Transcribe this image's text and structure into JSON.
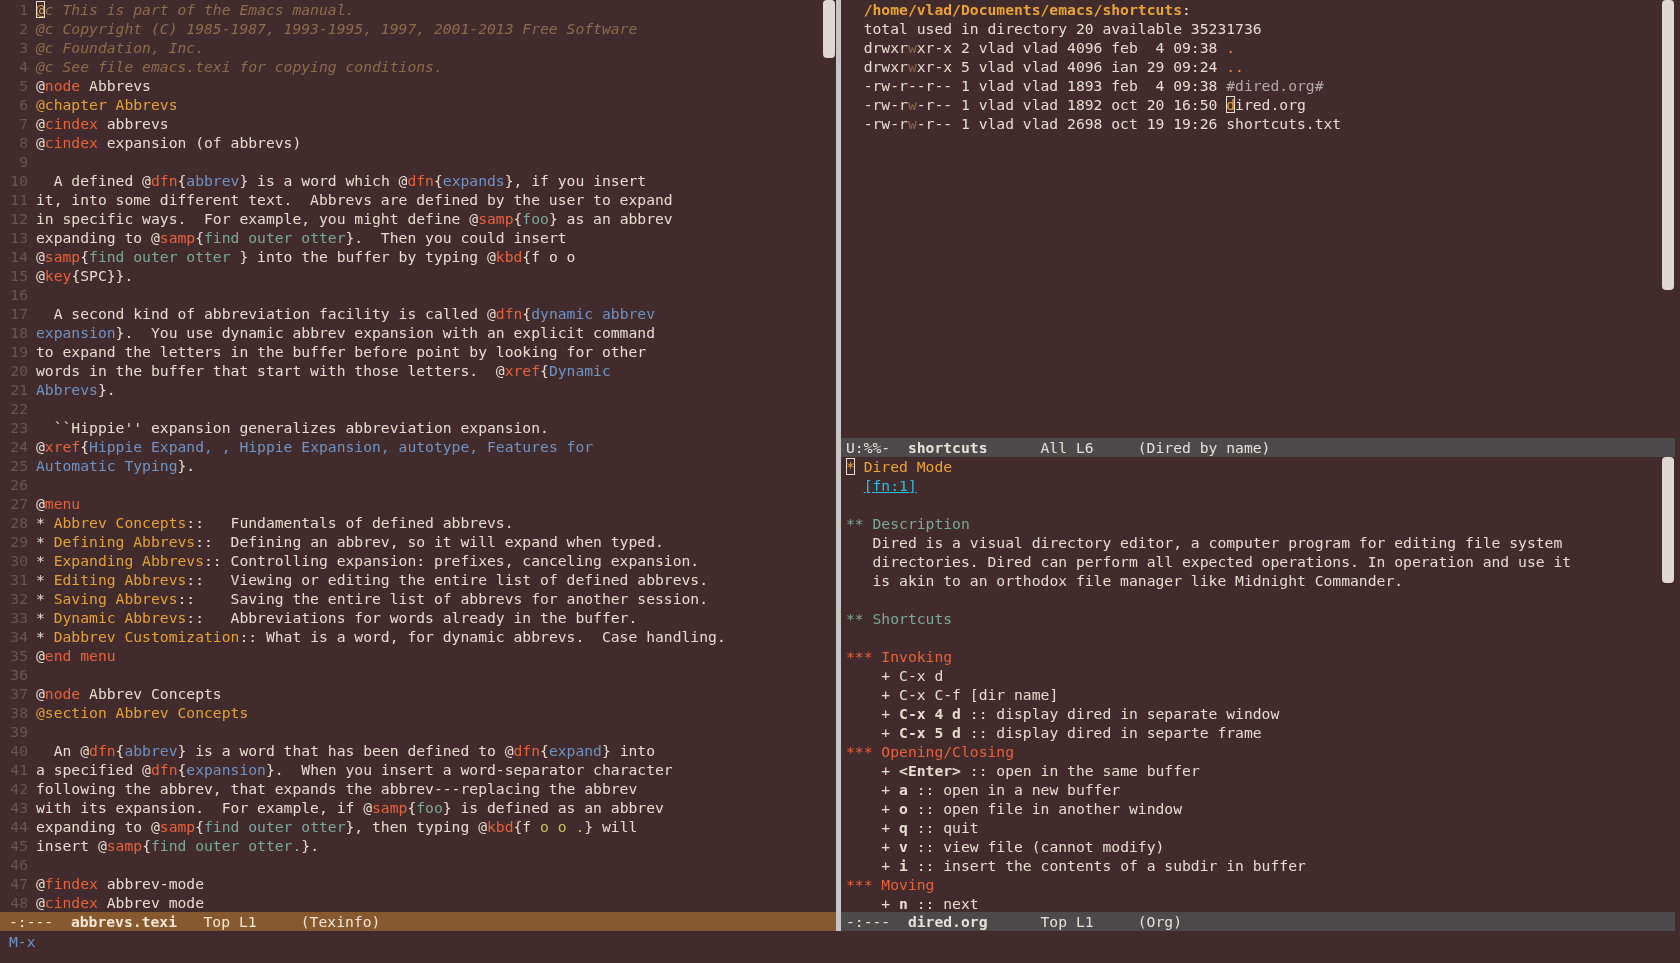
{
  "columns": [
    {
      "windows": [
        {
          "kind": "source",
          "lines": [
            {
              "number": "1",
              "spans": [
                {
                  "kind": "cursor",
                  "text": "@"
                },
                {
                  "kind": "comment",
                  "text": "c This is part of the Emacs manual."
                }
              ]
            },
            {
              "number": "2",
              "spans": [
                {
                  "kind": "comment",
                  "text": "@c Copyright (C) 1985-1987, 1993-1995, 1997, 2001-2013 Free Software"
                }
              ]
            },
            {
              "number": "3",
              "spans": [
                {
                  "kind": "comment",
                  "text": "@c Foundation, Inc."
                }
              ]
            },
            {
              "number": "4",
              "spans": [
                {
                  "kind": "comment",
                  "text": "@c See file emacs.texi for copying conditions."
                }
              ]
            },
            {
              "number": "5",
              "spans": [
                {
                  "kind": "plain",
                  "text": "@"
                },
                {
                  "kind": "keyword",
                  "text": "node"
                },
                {
                  "kind": "plain",
                  "text": " Abbrevs"
                }
              ]
            },
            {
              "number": "6",
              "spans": [
                {
                  "kind": "heading",
                  "text": "@chapter Abbrevs"
                }
              ]
            },
            {
              "number": "7",
              "spans": [
                {
                  "kind": "plain",
                  "text": "@"
                },
                {
                  "kind": "keyword",
                  "text": "cindex"
                },
                {
                  "kind": "plain",
                  "text": " abbrevs"
                }
              ]
            },
            {
              "number": "8",
              "spans": [
                {
                  "kind": "plain",
                  "text": "@"
                },
                {
                  "kind": "keyword",
                  "text": "cindex"
                },
                {
                  "kind": "plain",
                  "text": " expansion (of abbrevs)"
                }
              ]
            },
            {
              "number": "9"
            },
            {
              "number": "10",
              "spans": [
                {
                  "kind": "plain",
                  "text": "  A defined @"
                },
                {
                  "kind": "keyword",
                  "text": "dfn"
                },
                {
                  "kind": "plain",
                  "text": "{"
                },
                {
                  "kind": "ref",
                  "text": "abbrev"
                },
                {
                  "kind": "plain",
                  "text": "} is a word which @"
                },
                {
                  "kind": "keyword",
                  "text": "dfn"
                },
                {
                  "kind": "plain",
                  "text": "{"
                },
                {
                  "kind": "ref",
                  "text": "expands"
                },
                {
                  "kind": "plain",
                  "text": "}, if you insert"
                }
              ]
            },
            {
              "number": "11",
              "spans": [
                {
                  "kind": "plain",
                  "text": "it, into some different text.  Abbrevs are defined by the user to expand"
                }
              ]
            },
            {
              "number": "12",
              "spans": [
                {
                  "kind": "plain",
                  "text": "in specific ways.  For example, you might define @"
                },
                {
                  "kind": "keyword",
                  "text": "samp"
                },
                {
                  "kind": "plain",
                  "text": "{"
                },
                {
                  "kind": "sample",
                  "text": "foo"
                },
                {
                  "kind": "plain",
                  "text": "} as an abbrev"
                }
              ]
            },
            {
              "number": "13",
              "spans": [
                {
                  "kind": "plain",
                  "text": "expanding to @"
                },
                {
                  "kind": "keyword",
                  "text": "samp"
                },
                {
                  "kind": "plain",
                  "text": "{"
                },
                {
                  "kind": "sample",
                  "text": "find outer otter"
                },
                {
                  "kind": "plain",
                  "text": "}.  Then you could insert"
                }
              ]
            },
            {
              "number": "14",
              "spans": [
                {
                  "kind": "plain",
                  "text": "@"
                },
                {
                  "kind": "keyword",
                  "text": "samp"
                },
                {
                  "kind": "plain",
                  "text": "{"
                },
                {
                  "kind": "sample",
                  "text": "find outer otter "
                },
                {
                  "kind": "plain",
                  "text": "} into the buffer by typing @"
                },
                {
                  "kind": "keyword",
                  "text": "kbd"
                },
                {
                  "kind": "plain",
                  "text": "{f o o"
                }
              ]
            },
            {
              "number": "15",
              "spans": [
                {
                  "kind": "plain",
                  "text": "@"
                },
                {
                  "kind": "keyword",
                  "text": "key"
                },
                {
                  "kind": "plain",
                  "text": "{SPC}}."
                }
              ]
            },
            {
              "number": "16"
            },
            {
              "number": "17",
              "spans": [
                {
                  "kind": "plain",
                  "text": "  A second kind of abbreviation facility is called @"
                },
                {
                  "kind": "keyword",
                  "text": "dfn"
                },
                {
                  "kind": "plain",
                  "text": "{"
                },
                {
                  "kind": "ref",
                  "text": "dynamic abbrev"
                }
              ]
            },
            {
              "number": "18",
              "spans": [
                {
                  "kind": "ref",
                  "text": "expansion"
                },
                {
                  "kind": "plain",
                  "text": "}.  You use dynamic abbrev expansion with an explicit command"
                }
              ]
            },
            {
              "number": "19",
              "spans": [
                {
                  "kind": "plain",
                  "text": "to expand the letters in the buffer before point by looking for other"
                }
              ]
            },
            {
              "number": "20",
              "spans": [
                {
                  "kind": "plain",
                  "text": "words in the buffer that start with those letters.  @"
                },
                {
                  "kind": "keyword",
                  "text": "xref"
                },
                {
                  "kind": "plain",
                  "text": "{"
                },
                {
                  "kind": "ref",
                  "text": "Dynamic"
                }
              ]
            },
            {
              "number": "21",
              "spans": [
                {
                  "kind": "ref",
                  "text": "Abbrevs"
                },
                {
                  "kind": "plain",
                  "text": "}."
                }
              ]
            },
            {
              "number": "22"
            },
            {
              "number": "23",
              "spans": [
                {
                  "kind": "plain",
                  "text": "  ``Hippie'' expansion generalizes abbreviation expansion."
                }
              ]
            },
            {
              "number": "24",
              "spans": [
                {
                  "kind": "plain",
                  "text": "@"
                },
                {
                  "kind": "keyword",
                  "text": "xref"
                },
                {
                  "kind": "plain",
                  "text": "{"
                },
                {
                  "kind": "ref",
                  "text": "Hippie Expand, , Hippie Expansion, autotype, Features for"
                }
              ]
            },
            {
              "number": "25",
              "spans": [
                {
                  "kind": "ref",
                  "text": "Automatic Typing"
                },
                {
                  "kind": "plain",
                  "text": "}."
                }
              ]
            },
            {
              "number": "26"
            },
            {
              "number": "27",
              "spans": [
                {
                  "kind": "plain",
                  "text": "@"
                },
                {
                  "kind": "keyword",
                  "text": "menu"
                }
              ]
            },
            {
              "number": "28",
              "spans": [
                {
                  "kind": "plain",
                  "text": "* "
                },
                {
                  "kind": "heading",
                  "text": "Abbrev Concepts"
                },
                {
                  "kind": "plain",
                  "text": "::   Fundamentals of defined abbrevs."
                }
              ]
            },
            {
              "number": "29",
              "spans": [
                {
                  "kind": "plain",
                  "text": "* "
                },
                {
                  "kind": "heading",
                  "text": "Defining Abbrevs"
                },
                {
                  "kind": "plain",
                  "text": "::  Defining an abbrev, so it will expand when typed."
                }
              ]
            },
            {
              "number": "30",
              "spans": [
                {
                  "kind": "plain",
                  "text": "* "
                },
                {
                  "kind": "heading",
                  "text": "Expanding Abbrevs"
                },
                {
                  "kind": "plain",
                  "text": ":: Controlling expansion: prefixes, canceling expansion."
                }
              ]
            },
            {
              "number": "31",
              "spans": [
                {
                  "kind": "plain",
                  "text": "* "
                },
                {
                  "kind": "heading",
                  "text": "Editing Abbrevs"
                },
                {
                  "kind": "plain",
                  "text": "::   Viewing or editing the entire list of defined abbrevs."
                }
              ]
            },
            {
              "number": "32",
              "spans": [
                {
                  "kind": "plain",
                  "text": "* "
                },
                {
                  "kind": "heading",
                  "text": "Saving Abbrevs"
                },
                {
                  "kind": "plain",
                  "text": "::    Saving the entire list of abbrevs for another session."
                }
              ]
            },
            {
              "number": "33",
              "spans": [
                {
                  "kind": "plain",
                  "text": "* "
                },
                {
                  "kind": "heading",
                  "text": "Dynamic Abbrevs"
                },
                {
                  "kind": "plain",
                  "text": "::   Abbreviations for words already in the buffer."
                }
              ]
            },
            {
              "number": "34",
              "spans": [
                {
                  "kind": "plain",
                  "text": "* "
                },
                {
                  "kind": "heading",
                  "text": "Dabbrev Customization"
                },
                {
                  "kind": "plain",
                  "text": ":: What is a word, for dynamic abbrevs.  Case handling."
                }
              ]
            },
            {
              "number": "35",
              "spans": [
                {
                  "kind": "plain",
                  "text": "@"
                },
                {
                  "kind": "keyword",
                  "text": "end menu"
                }
              ]
            },
            {
              "number": "36"
            },
            {
              "number": "37",
              "spans": [
                {
                  "kind": "plain",
                  "text": "@"
                },
                {
                  "kind": "keyword",
                  "text": "node"
                },
                {
                  "kind": "plain",
                  "text": " Abbrev Concepts"
                }
              ]
            },
            {
              "number": "38",
              "spans": [
                {
                  "kind": "heading",
                  "text": "@section Abbrev Concepts"
                }
              ]
            },
            {
              "number": "39"
            },
            {
              "number": "40",
              "spans": [
                {
                  "kind": "plain",
                  "text": "  An @"
                },
                {
                  "kind": "keyword",
                  "text": "dfn"
                },
                {
                  "kind": "plain",
                  "text": "{"
                },
                {
                  "kind": "ref",
                  "text": "abbrev"
                },
                {
                  "kind": "plain",
                  "text": "} is a word that has been defined to @"
                },
                {
                  "kind": "keyword",
                  "text": "dfn"
                },
                {
                  "kind": "plain",
                  "text": "{"
                },
                {
                  "kind": "ref",
                  "text": "expand"
                },
                {
                  "kind": "plain",
                  "text": "} into"
                }
              ]
            },
            {
              "number": "41",
              "spans": [
                {
                  "kind": "plain",
                  "text": "a specified @"
                },
                {
                  "kind": "keyword",
                  "text": "dfn"
                },
                {
                  "kind": "plain",
                  "text": "{"
                },
                {
                  "kind": "ref",
                  "text": "expansion"
                },
                {
                  "kind": "plain",
                  "text": "}.  When you insert a word-separator character"
                }
              ]
            },
            {
              "number": "42",
              "spans": [
                {
                  "kind": "plain",
                  "text": "following the abbrev, that expands the abbrev---replacing the abbrev"
                }
              ]
            },
            {
              "number": "43",
              "spans": [
                {
                  "kind": "plain",
                  "text": "with its expansion.  For example, if @"
                },
                {
                  "kind": "keyword",
                  "text": "samp"
                },
                {
                  "kind": "plain",
                  "text": "{"
                },
                {
                  "kind": "sample",
                  "text": "foo"
                },
                {
                  "kind": "plain",
                  "text": "} is defined as an abbrev"
                }
              ]
            },
            {
              "number": "44",
              "spans": [
                {
                  "kind": "plain",
                  "text": "expanding to @"
                },
                {
                  "kind": "keyword",
                  "text": "samp"
                },
                {
                  "kind": "plain",
                  "text": "{"
                },
                {
                  "kind": "sample",
                  "text": "find outer otter"
                },
                {
                  "kind": "plain",
                  "text": "}, then typing @"
                },
                {
                  "kind": "keyword",
                  "text": "kbd"
                },
                {
                  "kind": "plain",
                  "text": "{f "
                },
                {
                  "kind": "keys",
                  "text": "o o ."
                },
                {
                  "kind": "plain",
                  "text": "} will"
                }
              ]
            },
            {
              "number": "45",
              "spans": [
                {
                  "kind": "plain",
                  "text": "insert @"
                },
                {
                  "kind": "keyword",
                  "text": "samp"
                },
                {
                  "kind": "plain",
                  "text": "{"
                },
                {
                  "kind": "sample",
                  "text": "find outer otter."
                },
                {
                  "kind": "plain",
                  "text": "}."
                }
              ]
            },
            {
              "number": "46"
            },
            {
              "number": "47",
              "spans": [
                {
                  "kind": "plain",
                  "text": "@"
                },
                {
                  "kind": "keyword",
                  "text": "findex"
                },
                {
                  "kind": "plain",
                  "text": " abbrev-mode"
                }
              ]
            },
            {
              "number": "48",
              "spans": [
                {
                  "kind": "plain",
                  "text": "@"
                },
                {
                  "kind": "keyword",
                  "text": "cindex"
                },
                {
                  "kind": "plain",
                  "text": " Abbrev mode"
                }
              ]
            }
          ],
          "mode_line": {
            "status": "-:---",
            "buffer": "abbrevs.texi",
            "position": "Top L1",
            "mode": "(Texinfo)",
            "active": true
          }
        }
      ]
    },
    {
      "windows": [
        {
          "kind": "listing",
          "lines": [
            {
              "spans": [
                {
                  "kind": "path",
                  "text": "/home/vlad/Documents/emacs/shortcuts"
                },
                {
                  "kind": "plain",
                  "text": ":"
                }
              ]
            },
            {
              "spans": [
                {
                  "kind": "plain",
                  "text": "total used in directory 20 available 35231736"
                }
              ]
            },
            {
              "spans": [
                {
                  "kind": "plain",
                  "text": "drwxr"
                },
                {
                  "kind": "dim",
                  "text": "w"
                },
                {
                  "kind": "plain",
                  "text": "xr-x 2 vlad vlad 4096 feb  4 09:38 "
                },
                {
                  "kind": "dot",
                  "text": "."
                }
              ]
            },
            {
              "spans": [
                {
                  "kind": "plain",
                  "text": "drwxr"
                },
                {
                  "kind": "dim",
                  "text": "w"
                },
                {
                  "kind": "plain",
                  "text": "xr-x 5 vlad vlad 4096 ian 29 09:24 "
                },
                {
                  "kind": "dot",
                  "text": ".."
                }
              ]
            },
            {
              "spans": [
                {
                  "kind": "plain",
                  "text": "-rw-r--r-- 1 vlad vlad 1893 feb  4 09:38 "
                },
                {
                  "kind": "backup",
                  "text": "#dired.org#"
                }
              ]
            },
            {
              "spans": [
                {
                  "kind": "plain",
                  "text": "-rw-r"
                },
                {
                  "kind": "dim",
                  "text": "w"
                },
                {
                  "kind": "plain",
                  "text": "-r-- 1 vlad vlad 1892 oct 20 16:50 "
                },
                {
                  "kind": "cursor",
                  "text": "d"
                },
                {
                  "kind": "plain",
                  "text": "ired.org"
                }
              ]
            },
            {
              "spans": [
                {
                  "kind": "plain",
                  "text": "-rw-r"
                },
                {
                  "kind": "dim",
                  "text": "w"
                },
                {
                  "kind": "plain",
                  "text": "-r-- 1 vlad vlad 2698 oct 19 19:26 shortcuts.txt"
                }
              ]
            }
          ],
          "mode_line": {
            "status": "U:%%-",
            "buffer": "shortcuts",
            "position": "All L6",
            "mode": "(Dired by name)",
            "active": false
          }
        },
        {
          "kind": "outline",
          "lines": [
            {
              "spans": [
                {
                  "kind": "cursor",
                  "text": "*"
                },
                {
                  "kind": "level1",
                  "text": " Dired Mode"
                }
              ]
            },
            {
              "spans": [
                {
                  "kind": "footnote",
                  "text": "[fn:1]"
                }
              ]
            },
            {
              "kind": "blank"
            },
            {
              "spans": [
                {
                  "kind": "level2",
                  "text": "** Description"
                }
              ]
            },
            {
              "spans": [
                {
                  "kind": "plain",
                  "text": "   Dired is a visual directory editor, a computer program for editing file system"
                }
              ]
            },
            {
              "spans": [
                {
                  "kind": "plain",
                  "text": "   directories. Dired can perform all expected operations. In operation and use it"
                }
              ]
            },
            {
              "spans": [
                {
                  "kind": "plain",
                  "text": "   is akin to an orthodox file manager like Midnight Commander."
                }
              ]
            },
            {
              "kind": "blank"
            },
            {
              "spans": [
                {
                  "kind": "level2",
                  "text": "** Shortcuts"
                }
              ]
            },
            {
              "kind": "blank"
            },
            {
              "spans": [
                {
                  "kind": "level3",
                  "text": "*** Invoking"
                }
              ]
            },
            {
              "spans": [
                {
                  "kind": "plain",
                  "text": "    + C-x d"
                }
              ]
            },
            {
              "spans": [
                {
                  "kind": "plain",
                  "text": "    + C-x C-f [dir name]"
                }
              ]
            },
            {
              "spans": [
                {
                  "kind": "plain",
                  "text": "    + "
                },
                {
                  "kind": "bold",
                  "text": "C-x 4 d"
                },
                {
                  "kind": "plain",
                  "text": " :: display dired in separate window"
                }
              ]
            },
            {
              "spans": [
                {
                  "kind": "plain",
                  "text": "    + "
                },
                {
                  "kind": "bold",
                  "text": "C-x 5 d"
                },
                {
                  "kind": "plain",
                  "text": " :: display dired in separte frame"
                }
              ]
            },
            {
              "spans": [
                {
                  "kind": "level3",
                  "text": "*** Opening/Closing"
                }
              ]
            },
            {
              "spans": [
                {
                  "kind": "plain",
                  "text": "    + "
                },
                {
                  "kind": "bold",
                  "text": "<Enter>"
                },
                {
                  "kind": "plain",
                  "text": " :: open in the same buffer"
                }
              ]
            },
            {
              "spans": [
                {
                  "kind": "plain",
                  "text": "    + "
                },
                {
                  "kind": "bold",
                  "text": "a"
                },
                {
                  "kind": "plain",
                  "text": " :: open in a new buffer"
                }
              ]
            },
            {
              "spans": [
                {
                  "kind": "plain",
                  "text": "    + "
                },
                {
                  "kind": "bold",
                  "text": "o"
                },
                {
                  "kind": "plain",
                  "text": " :: open file in another window"
                }
              ]
            },
            {
              "spans": [
                {
                  "kind": "plain",
                  "text": "    + "
                },
                {
                  "kind": "bold",
                  "text": "q"
                },
                {
                  "kind": "plain",
                  "text": " :: quit"
                }
              ]
            },
            {
              "spans": [
                {
                  "kind": "plain",
                  "text": "    + "
                },
                {
                  "kind": "bold",
                  "text": "v"
                },
                {
                  "kind": "plain",
                  "text": " :: view file (cannot modify)"
                }
              ]
            },
            {
              "spans": [
                {
                  "kind": "plain",
                  "text": "    + "
                },
                {
                  "kind": "bold",
                  "text": "i"
                },
                {
                  "kind": "plain",
                  "text": " :: insert the contents of a subdir in buffer"
                }
              ]
            },
            {
              "spans": [
                {
                  "kind": "level3",
                  "text": "*** Moving"
                }
              ]
            },
            {
              "spans": [
                {
                  "kind": "plain",
                  "text": "    + "
                },
                {
                  "kind": "bold",
                  "text": "n"
                },
                {
                  "kind": "plain",
                  "text": " :: next"
                }
              ]
            }
          ],
          "mode_line": {
            "status": "-:---",
            "buffer": "dired.org",
            "position": "Top L1",
            "mode": "(Org)",
            "active": false
          }
        }
      ]
    }
  ],
  "minibuffer": "M-x"
}
